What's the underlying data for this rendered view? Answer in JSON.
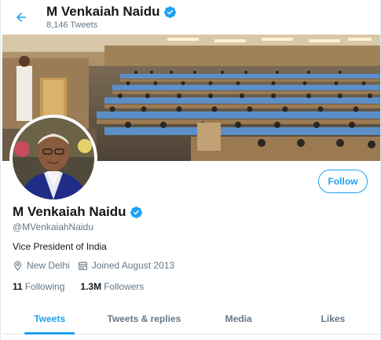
{
  "header": {
    "title": "M Venkaiah Naidu",
    "tweet_count": "8,146 Tweets",
    "back_icon": "arrow-left-icon"
  },
  "profile": {
    "display_name": "M Venkaiah Naidu",
    "handle": "@MVenkaiahNaidu",
    "bio": "Vice President of India",
    "location": "New Delhi",
    "joined": "Joined August 2013",
    "following_count": "11",
    "following_label": "Following",
    "followers_count": "1.3M",
    "followers_label": "Followers",
    "follow_button": "Follow"
  },
  "tabs": [
    {
      "label": "Tweets",
      "active": true
    },
    {
      "label": "Tweets & replies",
      "active": false
    },
    {
      "label": "Media",
      "active": false
    },
    {
      "label": "Likes",
      "active": false
    }
  ],
  "colors": {
    "accent": "#1da1f2",
    "text": "#14171a",
    "secondary": "#657786"
  }
}
